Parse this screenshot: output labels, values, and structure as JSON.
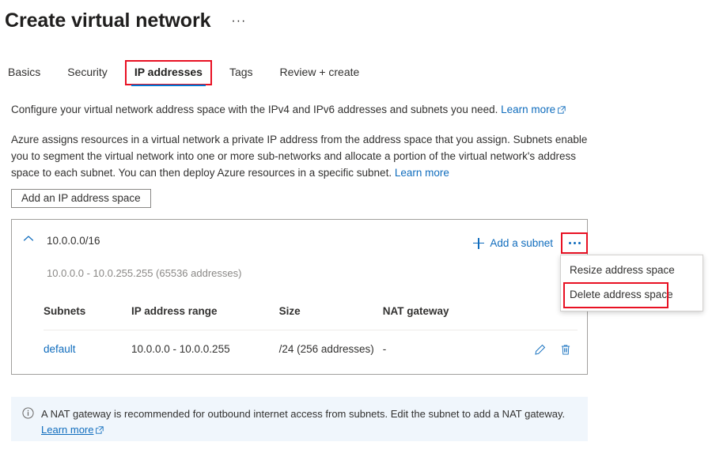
{
  "header": {
    "title": "Create virtual network",
    "more_options": "···"
  },
  "tabs": [
    {
      "label": "Basics",
      "active": false
    },
    {
      "label": "Security",
      "active": false
    },
    {
      "label": "IP addresses",
      "active": true
    },
    {
      "label": "Tags",
      "active": false
    },
    {
      "label": "Review + create",
      "active": false
    }
  ],
  "description": {
    "paragraph1_text": "Configure your virtual network address space with the IPv4 and IPv6 addresses and subnets you need. ",
    "paragraph1_link": "Learn more",
    "paragraph2_text": "Azure assigns resources in a virtual network a private IP address from the address space that you assign. Subnets enable you to segment the virtual network into one or more sub-networks and allocate a portion of the virtual network's address space to each subnet. You can then deploy Azure resources in a specific subnet. ",
    "paragraph2_link": "Learn more"
  },
  "actions": {
    "add_ip_address_space": "Add an IP address space"
  },
  "address_space": {
    "cidr": "10.0.0.0/16",
    "range_summary": "10.0.0.0 - 10.0.255.255 (65536 addresses)",
    "add_subnet_label": "Add a subnet",
    "overflow_label": "…"
  },
  "subnet_table": {
    "columns": [
      "Subnets",
      "IP address range",
      "Size",
      "NAT gateway"
    ],
    "rows": [
      {
        "name": "default",
        "ip_address_range": "10.0.0.0 - 10.0.0.255",
        "size": "/24 (256 addresses)",
        "nat_gateway": "-"
      }
    ]
  },
  "context_menu": {
    "items": [
      {
        "label": "Resize address space",
        "highlighted": false
      },
      {
        "label": "Delete address space",
        "highlighted": true
      }
    ]
  },
  "info_banner": {
    "message": "A NAT gateway is recommended for outbound internet access from subnets. Edit the subnet to add a NAT gateway.  ",
    "link": "Learn more"
  },
  "colors": {
    "link_blue": "#0f6cbd",
    "accent_blue": "#0078d4",
    "annotation_red": "#e81123",
    "info_bg": "#f0f6fc",
    "text": "#323130",
    "muted": "#8a8886"
  }
}
